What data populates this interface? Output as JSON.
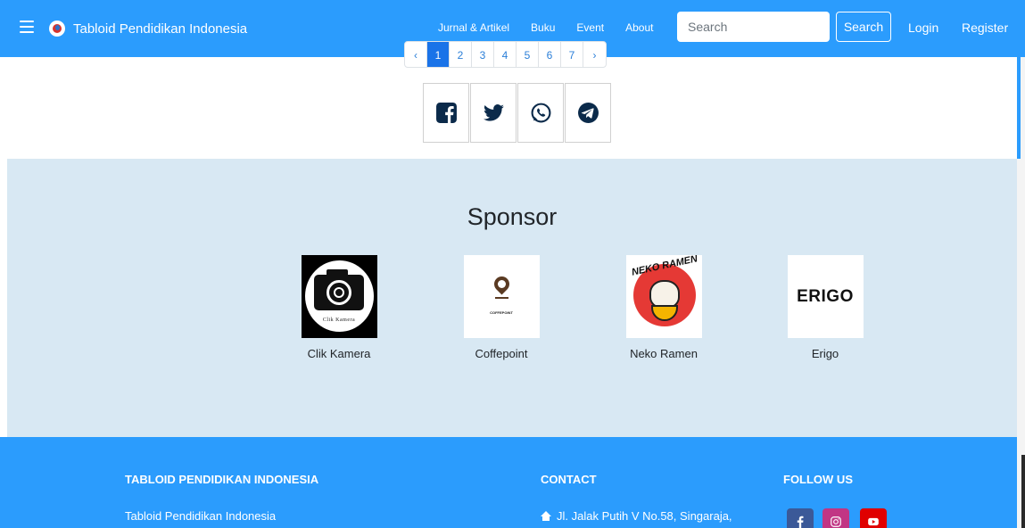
{
  "navbar": {
    "brand": "Tabloid Pendidikan Indonesia",
    "links": [
      "Jurnal & Artikel",
      "Buku",
      "Event",
      "About"
    ],
    "search_placeholder": "Search",
    "search_button": "Search",
    "login": "Login",
    "register": "Register"
  },
  "pagination": {
    "prev": "‹",
    "pages": [
      "1",
      "2",
      "3",
      "4",
      "5",
      "6",
      "7"
    ],
    "next": "›",
    "active": "1"
  },
  "share": {
    "icons": [
      "facebook-icon",
      "twitter-icon",
      "whatsapp-icon",
      "telegram-icon"
    ]
  },
  "sponsor": {
    "title": "Sponsor",
    "items": [
      {
        "name": "Clik Kamera",
        "logo_text": "Clik Kamera"
      },
      {
        "name": "Coffepoint",
        "logo_text": "COFFEPOINT"
      },
      {
        "name": "Neko Ramen",
        "logo_text": "NEKO RAMEN"
      },
      {
        "name": "Erigo",
        "logo_text": "ERIGO"
      }
    ]
  },
  "footer": {
    "about_heading": "TABLOID PENDIDIKAN INDONESIA",
    "about_text": "Tabloid Pendidikan Indonesia",
    "contact_heading": "CONTACT",
    "contact_address": "Jl. Jalak Putih V No.58, Singaraja,",
    "follow_heading": "FOLLOW US",
    "social": [
      {
        "icon": "facebook-icon",
        "color": "#3b5998"
      },
      {
        "icon": "instagram-icon",
        "color": "#c13584"
      },
      {
        "icon": "youtube-icon",
        "color": "#e00000"
      }
    ]
  },
  "colors": {
    "primary": "#2b9cfd",
    "sponsor_bg": "#d8e8f3",
    "active_page": "#1a73e8",
    "share_icon": "#0b2a4a"
  }
}
